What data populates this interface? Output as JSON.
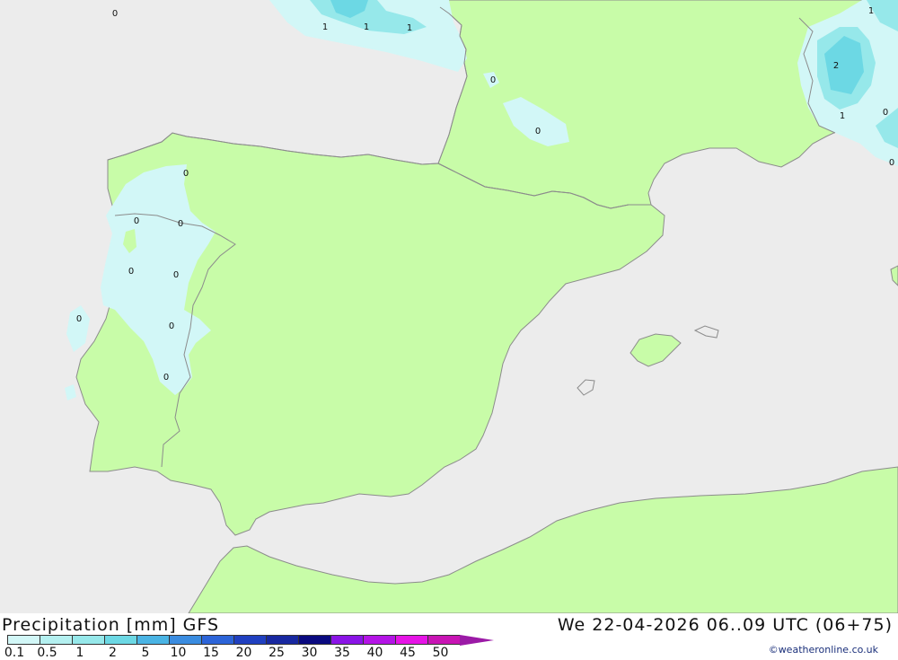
{
  "header": {
    "title": "Precipitation [mm] GFS",
    "datetime": "We 22-04-2026 06..09 UTC (06+75)"
  },
  "legend": {
    "values": [
      "0.1",
      "0.5",
      "1",
      "2",
      "5",
      "10",
      "15",
      "20",
      "25",
      "30",
      "35",
      "40",
      "45",
      "50"
    ],
    "colors": [
      "#d2f7f7",
      "#b4f0f0",
      "#96e8ea",
      "#6cd8e4",
      "#4ab4e4",
      "#3a8ce0",
      "#2c64d8",
      "#2040c0",
      "#1828a0",
      "#0a0a80",
      "#8a14e6",
      "#b414e6",
      "#e614e6",
      "#c814b4"
    ]
  },
  "credit": "©weatheronline.co.uk",
  "map": {
    "colors": {
      "sea": "#ececec",
      "land": "#c8fca8",
      "rain_light": "#d2f7f7",
      "rain_mid": "#96e8ea",
      "rain_heavy": "#6cd8e4",
      "border": "#8c8c8c"
    },
    "contour_labels": [
      "0",
      "1",
      "1",
      "1",
      "0",
      "0",
      "0",
      "0",
      "0",
      "0",
      "0",
      "0",
      "0",
      "0",
      "1",
      "2",
      "1",
      "0",
      "0"
    ]
  }
}
